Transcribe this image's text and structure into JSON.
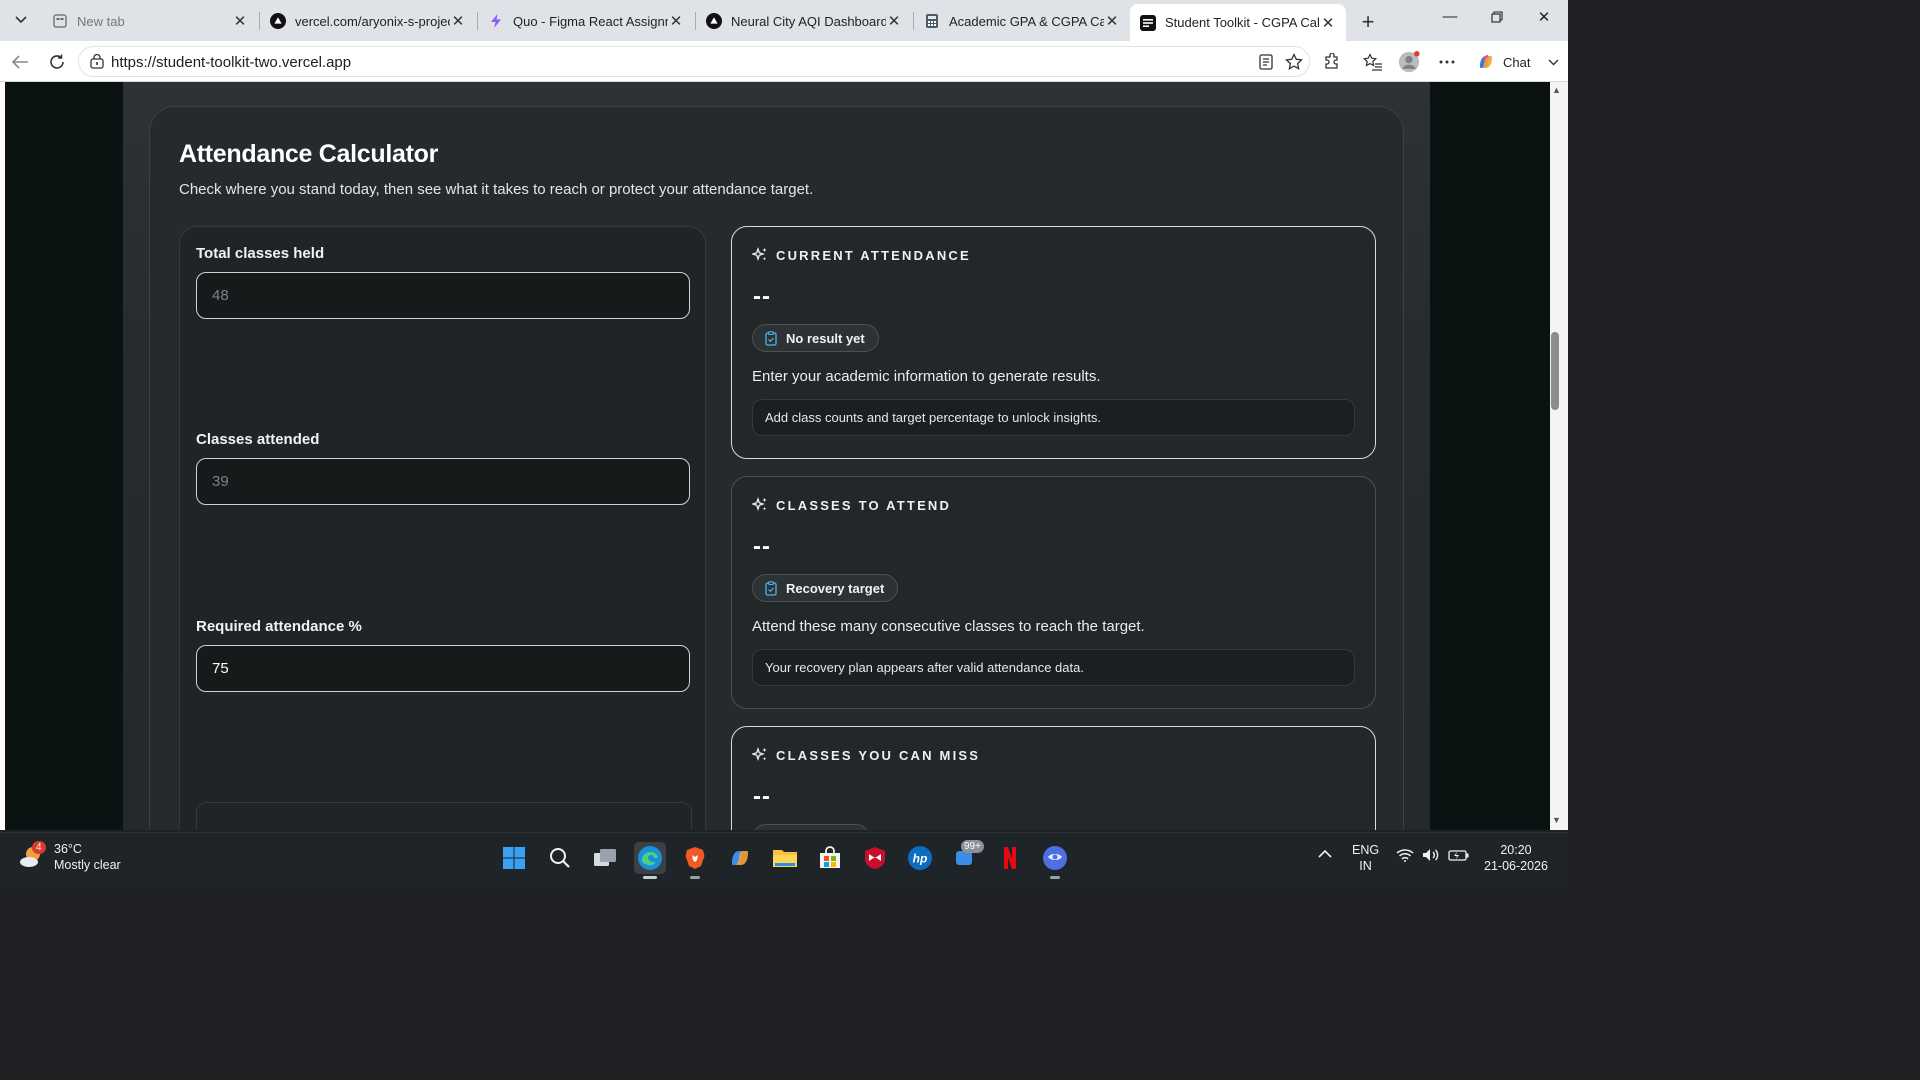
{
  "browser": {
    "tabs": [
      {
        "title": "New tab",
        "state": "inactive"
      },
      {
        "title": "vercel.com/aryonix-s-projects",
        "state": "inactive"
      },
      {
        "title": "Quo - Figma React Assignment",
        "state": "inactive"
      },
      {
        "title": "Neural City AQI Dashboard",
        "state": "inactive"
      },
      {
        "title": "Academic GPA & CGPA Calculator",
        "state": "inactive"
      },
      {
        "title": "Student Toolkit - CGPA Calculator",
        "state": "active"
      }
    ],
    "url": "https://student-toolkit-two.vercel.app",
    "chat_label": "Chat"
  },
  "page": {
    "title": "Attendance Calculator",
    "subtitle": "Check where you stand today, then see what it takes to reach or protect your attendance target.",
    "form": {
      "total_classes": {
        "label": "Total classes held",
        "placeholder": "48",
        "value": ""
      },
      "classes_attended": {
        "label": "Classes attended",
        "placeholder": "39",
        "value": ""
      },
      "required_attendance": {
        "label": "Required attendance %",
        "placeholder": "",
        "value": "75"
      }
    },
    "results": [
      {
        "heading": "CURRENT ATTENDANCE",
        "value": "--",
        "badge": "No result yet",
        "description": "Enter your academic information to generate results.",
        "note": "Add class counts and target percentage to unlock insights."
      },
      {
        "heading": "CLASSES TO ATTEND",
        "value": "--",
        "badge": "Recovery target",
        "description": "Attend these many consecutive classes to reach the target.",
        "note": "Your recovery plan appears after valid attendance data."
      },
      {
        "heading": "CLASSES YOU CAN MISS",
        "value": "--"
      }
    ]
  },
  "taskbar": {
    "weather": {
      "temp": "36°C",
      "condition": "Mostly clear",
      "badge": "4"
    },
    "notification_badge": "99+",
    "lang": {
      "line1": "ENG",
      "line2": "IN"
    },
    "clock": {
      "time": "20:20",
      "date": "21-06-2026"
    }
  }
}
